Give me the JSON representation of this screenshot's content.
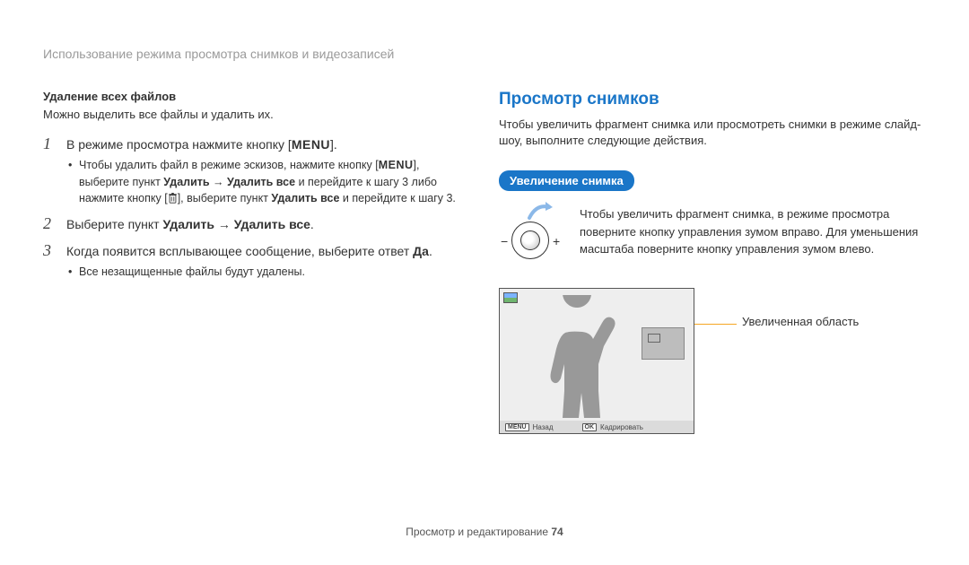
{
  "breadcrumb": "Использование режима просмотра снимков и видеозаписей",
  "left": {
    "subheading": "Удаление всех файлов",
    "intro": "Можно выделить все файлы и удалить их.",
    "step1_pre": "В режиме просмотра нажмите кнопку [",
    "step1_menu": "MENU",
    "step1_post": "].",
    "step1_bullet_a": "Чтобы удалить файл в режиме эскизов, нажмите кнопку [",
    "step1_bullet_a_menu": "MENU",
    "step1_bullet_a_post": "],",
    "step1_bullet_b_pre": "выберите пункт ",
    "step1_bullet_b_bold": "Удалить → Удалить все",
    "step1_bullet_b_mid": " и перейдите к шагу 3 либо нажмите кнопку [",
    "step1_bullet_b_post": "], выберите пункт ",
    "step1_bullet_b_bold2": "Удалить все",
    "step1_bullet_b_end": " и перейдите к шагу 3.",
    "step2_pre": "Выберите пункт ",
    "step2_bold": "Удалить → Удалить все",
    "step2_post": ".",
    "step3_pre": "Когда появится всплывающее сообщение, выберите ответ ",
    "step3_bold": "Да",
    "step3_post": ".",
    "step3_bullet": "Все незащищенные файлы будут удалены."
  },
  "right": {
    "title": "Просмотр снимков",
    "intro": "Чтобы увеличить фрагмент снимка или просмотреть снимки в режиме слайд-шоу, выполните следующие действия.",
    "pill": "Увеличение снимка",
    "zoom_text": "Чтобы увеличить фрагмент снимка, в режиме просмотра поверните кнопку управления зумом вправо. Для уменьшения масштаба поверните кнопку управления зумом влево.",
    "callout": "Увеличенная область",
    "footer_back_btn": "MENU",
    "footer_back": "Назад",
    "footer_ok_btn": "OK",
    "footer_crop": "Кадрировать"
  },
  "footer": {
    "text": "Просмотр и редактирование  ",
    "page": "74"
  }
}
